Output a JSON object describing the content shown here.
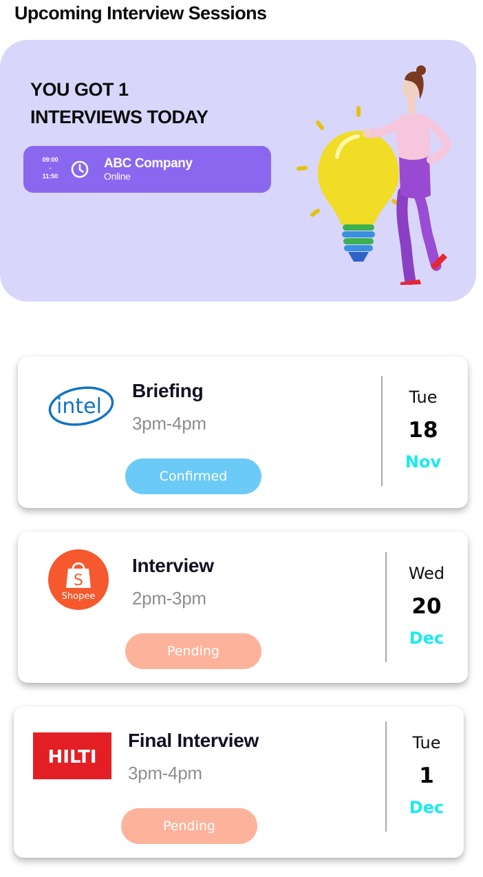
{
  "header": {
    "title": "Upcoming Interview Sessions"
  },
  "hero": {
    "headline_line1": "YOU GOT 1",
    "headline_line2": "INTERVIEWS TODAY",
    "today": {
      "start_time": "09:00",
      "separator": "-",
      "end_time": "11:50",
      "company": "ABC Company",
      "mode": "Online"
    }
  },
  "interviews": [
    {
      "company_logo": "intel-logo",
      "logo_text": "intel",
      "title": "Briefing",
      "time": "3pm-4pm",
      "status": "Confirmed",
      "weekday": "Tue",
      "day": "18",
      "month": "Nov"
    },
    {
      "company_logo": "shopee-logo",
      "logo_text": "Shopee",
      "title": "Interview",
      "time": "2pm-3pm",
      "status": "Pending",
      "weekday": "Wed",
      "day": "20",
      "month": "Dec"
    },
    {
      "company_logo": "hilti-logo",
      "logo_text": "HILTI",
      "title": "Final Interview",
      "time": "3pm-4pm",
      "status": "Pending",
      "weekday": "Tue",
      "day": "1",
      "month": "Dec"
    }
  ],
  "colors": {
    "hero_bg": "#d9d6fb",
    "pill_bg": "#8b67f0",
    "confirmed": "#6ccaf7",
    "pending": "#fdb39b",
    "month_accent": "#18eaf2"
  }
}
